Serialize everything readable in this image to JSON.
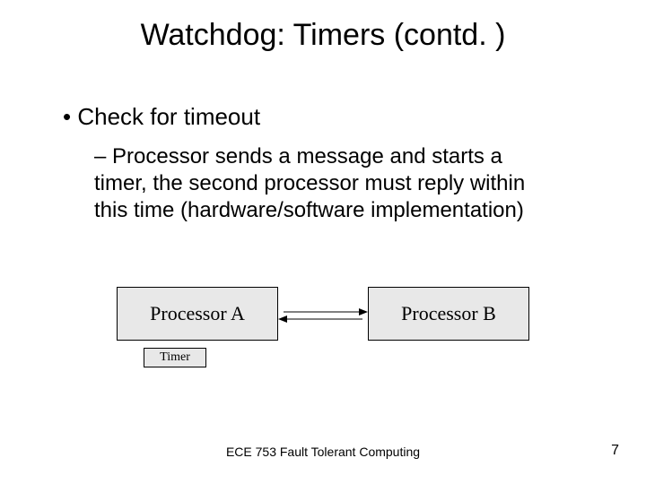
{
  "title": "Watchdog: Timers (contd. )",
  "bullet": "Check for timeout",
  "subbullet": "Processor sends a message and starts a timer, the second processor must reply within this time (hardware/software implementation)",
  "diagram": {
    "boxA": "Processor A",
    "boxB": "Processor B",
    "timer": "Timer"
  },
  "footer": "ECE 753 Fault Tolerant Computing",
  "page": "7"
}
